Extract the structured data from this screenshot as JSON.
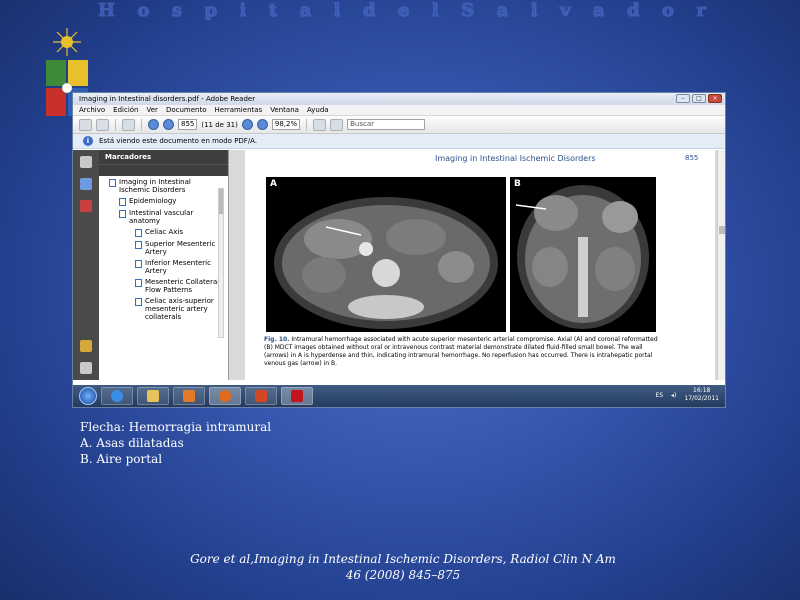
{
  "slide": {
    "title_letters": [
      "H",
      "o",
      "s",
      "p",
      "i",
      "t",
      "a",
      "l",
      "",
      "d",
      "e",
      "l",
      "",
      "S",
      "a",
      "l",
      "v",
      "a",
      "d",
      "o",
      "r"
    ],
    "notes": [
      "Flecha: Hemorragia intramural",
      "A. Asas dilatadas",
      "B. Aire portal"
    ],
    "citation_line1": "Gore et al,Imaging in Intestinal Ischemic Disorders, Radiol Clin N Am",
    "citation_line2": "46 (2008) 845–875"
  },
  "reader": {
    "window_title": "Imaging in Intestinal disorders.pdf - Adobe Reader",
    "menu": [
      "Archivo",
      "Edición",
      "Ver",
      "Documento",
      "Herramientas",
      "Ventana",
      "Ayuda"
    ],
    "page_field": "855",
    "page_count": "(11 de 31)",
    "zoom": "98,2%",
    "search_placeholder": "Buscar",
    "info_message": "Está viendo este documento en modo PDF/A.",
    "bookmarks_title": "Marcadores",
    "bookmarks": [
      {
        "label": "Imaging in Intestinal Ischemic Disorders",
        "level": 0
      },
      {
        "label": "Epidemiology",
        "level": 1
      },
      {
        "label": "Intestinal vascular anatomy",
        "level": 1
      },
      {
        "label": "Celiac Axis",
        "level": 2
      },
      {
        "label": "Superior Mesenteric Artery",
        "level": 2
      },
      {
        "label": "Inferior Mesenteric Artery",
        "level": 2
      },
      {
        "label": "Mesenteric Collateral Flow Patterns",
        "level": 2
      },
      {
        "label": "Celiac axis-superior mesenteric artery collaterals",
        "level": 2
      }
    ],
    "page": {
      "header": "Imaging in Intestinal Ischemic Disorders",
      "number": "855",
      "panel_a": "A",
      "panel_b": "B",
      "fig_label": "Fig. 10.",
      "caption": "Intramural hemorrhage associated with acute superior mesenteric arterial compromise. Axial (A) and coronal reformatted (B) MDCT images obtained without oral or intravenous contrast material demonstrate dilated fluid-filled small bowel. The wall (arrows) in A is hyperdense and thin, indicating intramural hemorrhage. No reperfusion has occurred. There is intrahepatic portal venous gas (arrow) in B."
    },
    "taskbar": {
      "lang": "ES",
      "time": "16:18",
      "date": "17/02/2011"
    }
  }
}
